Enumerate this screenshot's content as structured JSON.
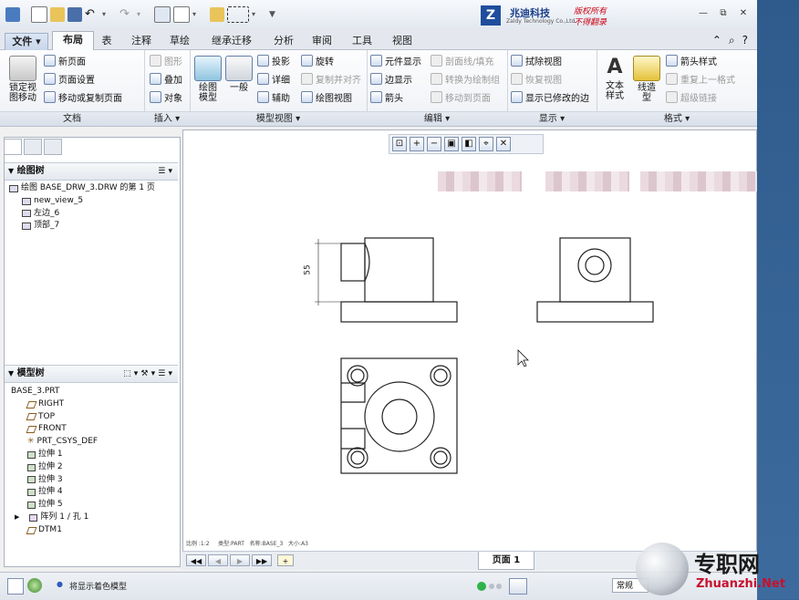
{
  "titlebar": {
    "logo_mark": "Z",
    "company_cn": "兆迪科技",
    "company_en": "Zaldy Technology Co.,Ltd.",
    "slogan_line1": "版权所有",
    "slogan_line2": "不得翻录",
    "minimize": "—",
    "restore": "⧉",
    "close": "✕"
  },
  "tabs": [
    {
      "label": "文件 ▾"
    },
    {
      "label": "布局"
    },
    {
      "label": "表"
    },
    {
      "label": "注释"
    },
    {
      "label": "草绘"
    },
    {
      "label": "继承迁移"
    },
    {
      "label": "分析"
    },
    {
      "label": "审阅"
    },
    {
      "label": "工具"
    },
    {
      "label": "视图"
    }
  ],
  "ribbon": {
    "doc_group": {
      "name": "文档",
      "lock_label": "锁定视\n图移动",
      "new_page": "新页面",
      "page_setup": "页面设置",
      "move_copy": "移动或复制页面"
    },
    "insert_group": {
      "name": "插入 ▾",
      "graphics": "图形",
      "overlay": "叠加",
      "object": "对象"
    },
    "model_view_group": {
      "name": "模型视图 ▾",
      "drawing_model": "绘图\n模型",
      "general": "一般",
      "projection": "投影",
      "detailed": "详细",
      "auxiliary": "辅助",
      "revolve": "旋转",
      "copy_align": "复制并对齐",
      "drawing_view": "绘图视图"
    },
    "edit_group": {
      "name": "编辑 ▾",
      "component_display": "元件显示",
      "edge_display": "边显示",
      "arrow": "箭头",
      "section_fill": "剖面线/填充",
      "convert_group": "转换为绘制组",
      "move_to_page": "移动到页面"
    },
    "display_group": {
      "name": "显示 ▾",
      "erase_view": "拭除视图",
      "restore_view": "恢复视图",
      "show_modified": "显示已修改的边"
    },
    "format_group": {
      "name": "格式 ▾",
      "text_style": "文本\n样式",
      "line_style": "线造\n型",
      "arrow_style": "箭头样式",
      "repeat_format": "重复上一格式",
      "hyperlink": "超级链接"
    }
  },
  "drawing_tree": {
    "title": "绘图树",
    "items": [
      "绘图 BASE_DRW_3.DRW 的第 1 页",
      "new_view_5",
      "左边_6",
      "顶部_7"
    ]
  },
  "model_tree": {
    "title": "模型树",
    "items": [
      "BASE_3.PRT",
      "RIGHT",
      "TOP",
      "FRONT",
      "PRT_CSYS_DEF",
      "拉伸 1",
      "拉伸 2",
      "拉伸 3",
      "拉伸 4",
      "拉伸 5",
      "阵列 1 / 孔 1",
      "DTM1"
    ]
  },
  "drawing": {
    "dimension": "55",
    "status_scale": "比例 :1:2",
    "status_type": "类型:PART",
    "status_name": "名称:BASE_3",
    "status_size": "大小:A3"
  },
  "pagebar": {
    "page_label": "页面 1"
  },
  "statusbar": {
    "message": "将显示着色模型",
    "filter": "常规"
  },
  "watermark": {
    "cn": "专职网",
    "en": "Zhuanzhi.Net"
  }
}
